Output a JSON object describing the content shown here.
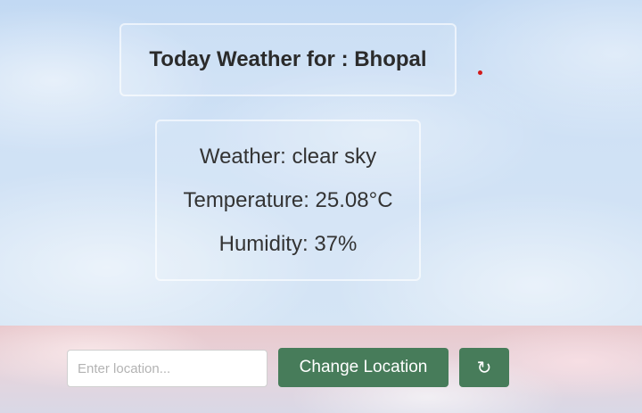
{
  "header": {
    "title": "Today Weather for : Bhopal"
  },
  "weather": {
    "condition_line": "Weather: clear sky",
    "temperature_line": "Temperature: 25.08°C",
    "humidity_line": "Humidity: 37%"
  },
  "controls": {
    "location_input_value": "",
    "location_input_placeholder": "Enter location...",
    "change_location_label": "Change Location",
    "refresh_icon": "refresh-icon",
    "refresh_glyph": "↻"
  },
  "colors": {
    "button_bg": "#477c5a",
    "title_text": "#2b2b2b",
    "indicator_dot": "#d11a1a"
  }
}
